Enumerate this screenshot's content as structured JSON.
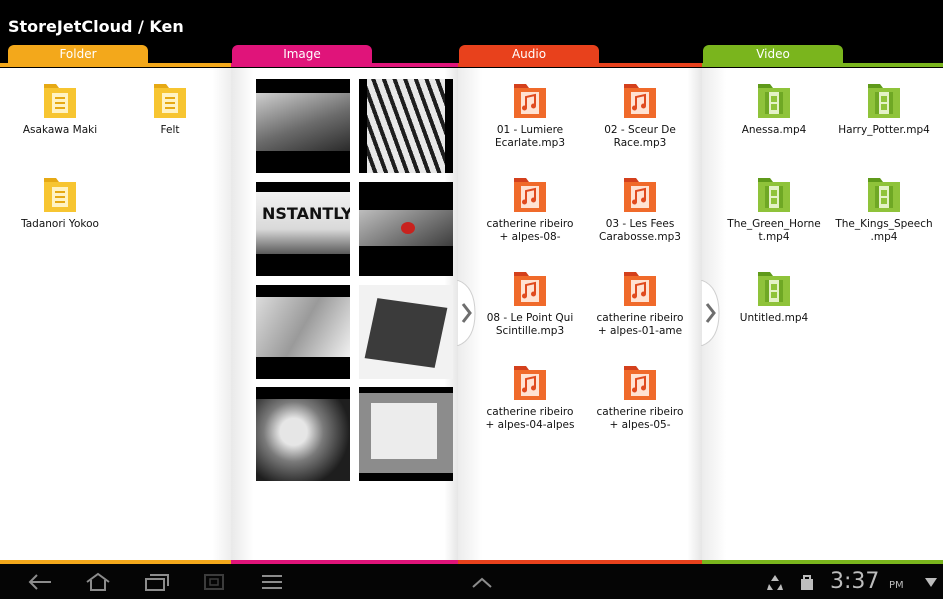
{
  "header": {
    "title": "StoreJetCloud / Ken"
  },
  "tabs": [
    {
      "label": "Folder",
      "color": "#f3a81b"
    },
    {
      "label": "Image",
      "color": "#e0147a"
    },
    {
      "label": "Audio",
      "color": "#e8411c"
    },
    {
      "label": "Video",
      "color": "#7ab51d"
    }
  ],
  "folders": [
    {
      "name": "Asakawa Maki"
    },
    {
      "name": "Felt"
    },
    {
      "name": "Tadanori Yokoo"
    }
  ],
  "audio": [
    {
      "line1": "01 - Lumiere",
      "line2": "Ecarlate.mp3"
    },
    {
      "line1": "02 - Sceur De",
      "line2": "Race.mp3"
    },
    {
      "line1": "catherine ribeiro",
      "line2": "+ alpes-08-"
    },
    {
      "line1": "03 - Les Fees",
      "line2": "Carabosse.mp3"
    },
    {
      "line1": "08 - Le Point Qui",
      "line2": "Scintille.mp3"
    },
    {
      "line1": "catherine ribeiro",
      "line2": "+ alpes-01-ame"
    },
    {
      "line1": "catherine ribeiro",
      "line2": "+ alpes-04-alpes"
    },
    {
      "line1": "catherine ribeiro",
      "line2": "+ alpes-05-"
    }
  ],
  "video": [
    {
      "line1": "Anessa.mp4",
      "line2": ""
    },
    {
      "line1": "Harry_Potter.mp4",
      "line2": ""
    },
    {
      "line1": "The_Green_Horne",
      "line2": "t.mp4"
    },
    {
      "line1": "The_Kings_Speech",
      "line2": ".mp4"
    },
    {
      "line1": "Untitled.mp4",
      "line2": ""
    }
  ],
  "images": [
    {
      "name": "book-photo-thumbnail"
    },
    {
      "name": "ink-drawing-thumbnail"
    },
    {
      "name": "instantly-card-thumbnail"
    },
    {
      "name": "red-object-thumbnail"
    },
    {
      "name": "collage-thumbnail"
    },
    {
      "name": "folded-paper-thumbnail"
    },
    {
      "name": "portrait-art-thumbnail"
    },
    {
      "name": "papers-on-table-thumbnail"
    }
  ],
  "statusbar": {
    "time": "3:37",
    "ampm": "PM"
  }
}
